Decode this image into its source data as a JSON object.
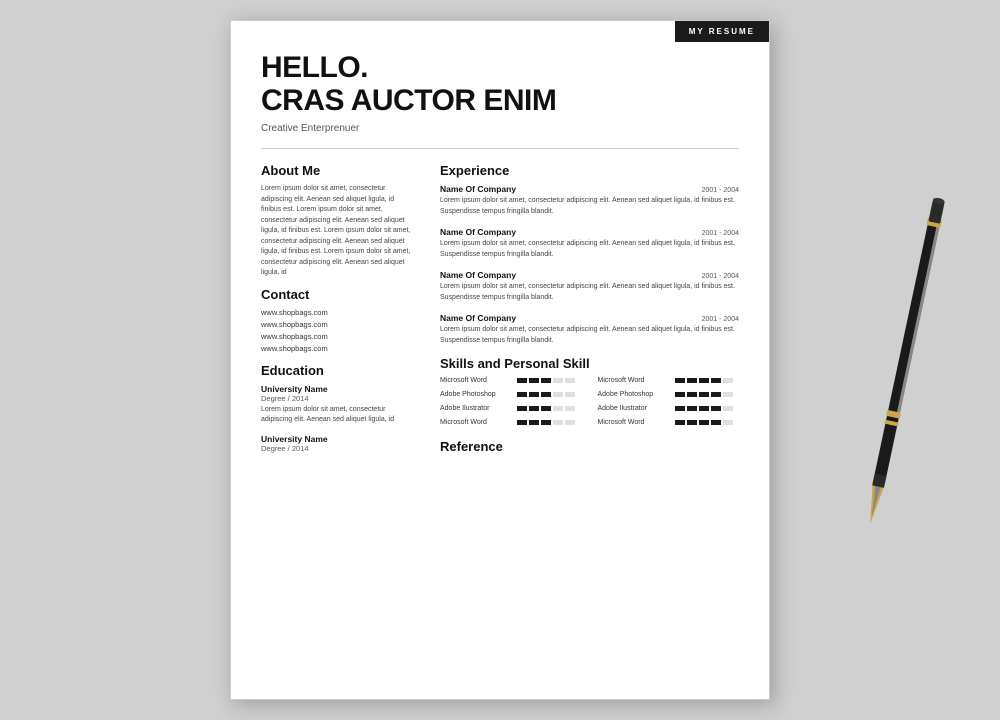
{
  "badge": "MY RESUME",
  "header": {
    "hello": "HELLO.",
    "name": "CRAS AUCTOR ENIM",
    "title": "Creative Enterprenuer"
  },
  "about": {
    "label": "About Me",
    "text": "Lorem ipsum dolor sit amet, consectetur adipiscing elit. Aenean sed aliquet ligula, id finibus est. Lorem ipsum dolor sit amet, consectetur adipiscing elit. Aenean sed aliquet ligula, id finibus est. Lorem ipsum dolor sit amet, consectetur adipiscing elit. Aenean sed aliquet ligula, id finibus est. Lorem ipsum dolor sit amet, consectetur adipiscing elit. Aenean sed aliquet ligula, id"
  },
  "contact": {
    "label": "Contact",
    "links": [
      "www.shopbags.com",
      "www.shopbags.com",
      "www.shopbags.com",
      "www.shopbags.com"
    ]
  },
  "education": {
    "label": "Education",
    "items": [
      {
        "name": "University Name",
        "degree": "Degree / 2014",
        "text": "Lorem ipsum dolor sit amet, consectetur adipiscing elit. Aenean sed aliquet ligula, id"
      },
      {
        "name": "University Name",
        "degree": "Degree / 2014",
        "text": ""
      }
    ]
  },
  "experience": {
    "label": "Experience",
    "items": [
      {
        "company": "Name Of Company",
        "dates": "2001 - 2004",
        "text": "Lorem ipsum dolor sit amet, consectetur adipiscing elit. Aenean sed aliquet ligula, id finibus est. Suspendisse tempus fringilla blandit."
      },
      {
        "company": "Name Of Company",
        "dates": "2001 - 2004",
        "text": "Lorem ipsum dolor sit amet, consectetur adipiscing elit. Aenean sed aliquet ligula, id finibus est. Suspendisse tempus fringilla blandit."
      },
      {
        "company": "Name Of Company",
        "dates": "2001 - 2004",
        "text": "Lorem ipsum dolor sit amet, consectetur adipiscing elit. Aenean sed aliquet ligula, id finibus est. Suspendisse tempus fringilla blandit."
      },
      {
        "company": "Name Of Company",
        "dates": "2001 - 2004",
        "text": "Lorem ipsum dolor sit amet, consectetur adipiscing elit. Aenean sed aliquet ligula, id finibus est. Suspendisse tempus fringilla blandit."
      }
    ]
  },
  "skills": {
    "label": "Skills and Personal Skill",
    "items": [
      {
        "name": "Microsoft  Word",
        "level": 3
      },
      {
        "name": "Microsoft  Word",
        "level": 4
      },
      {
        "name": "Adobe Photoshop",
        "level": 3
      },
      {
        "name": "Adobe Photoshop",
        "level": 4
      },
      {
        "name": "Adobe Ilustrator",
        "level": 3
      },
      {
        "name": "Adobe Ilustrator",
        "level": 4
      },
      {
        "name": "Microsoft  Word",
        "level": 3
      },
      {
        "name": "Microsoft  Word",
        "level": 4
      }
    ]
  },
  "reference": {
    "label": "Reference"
  }
}
